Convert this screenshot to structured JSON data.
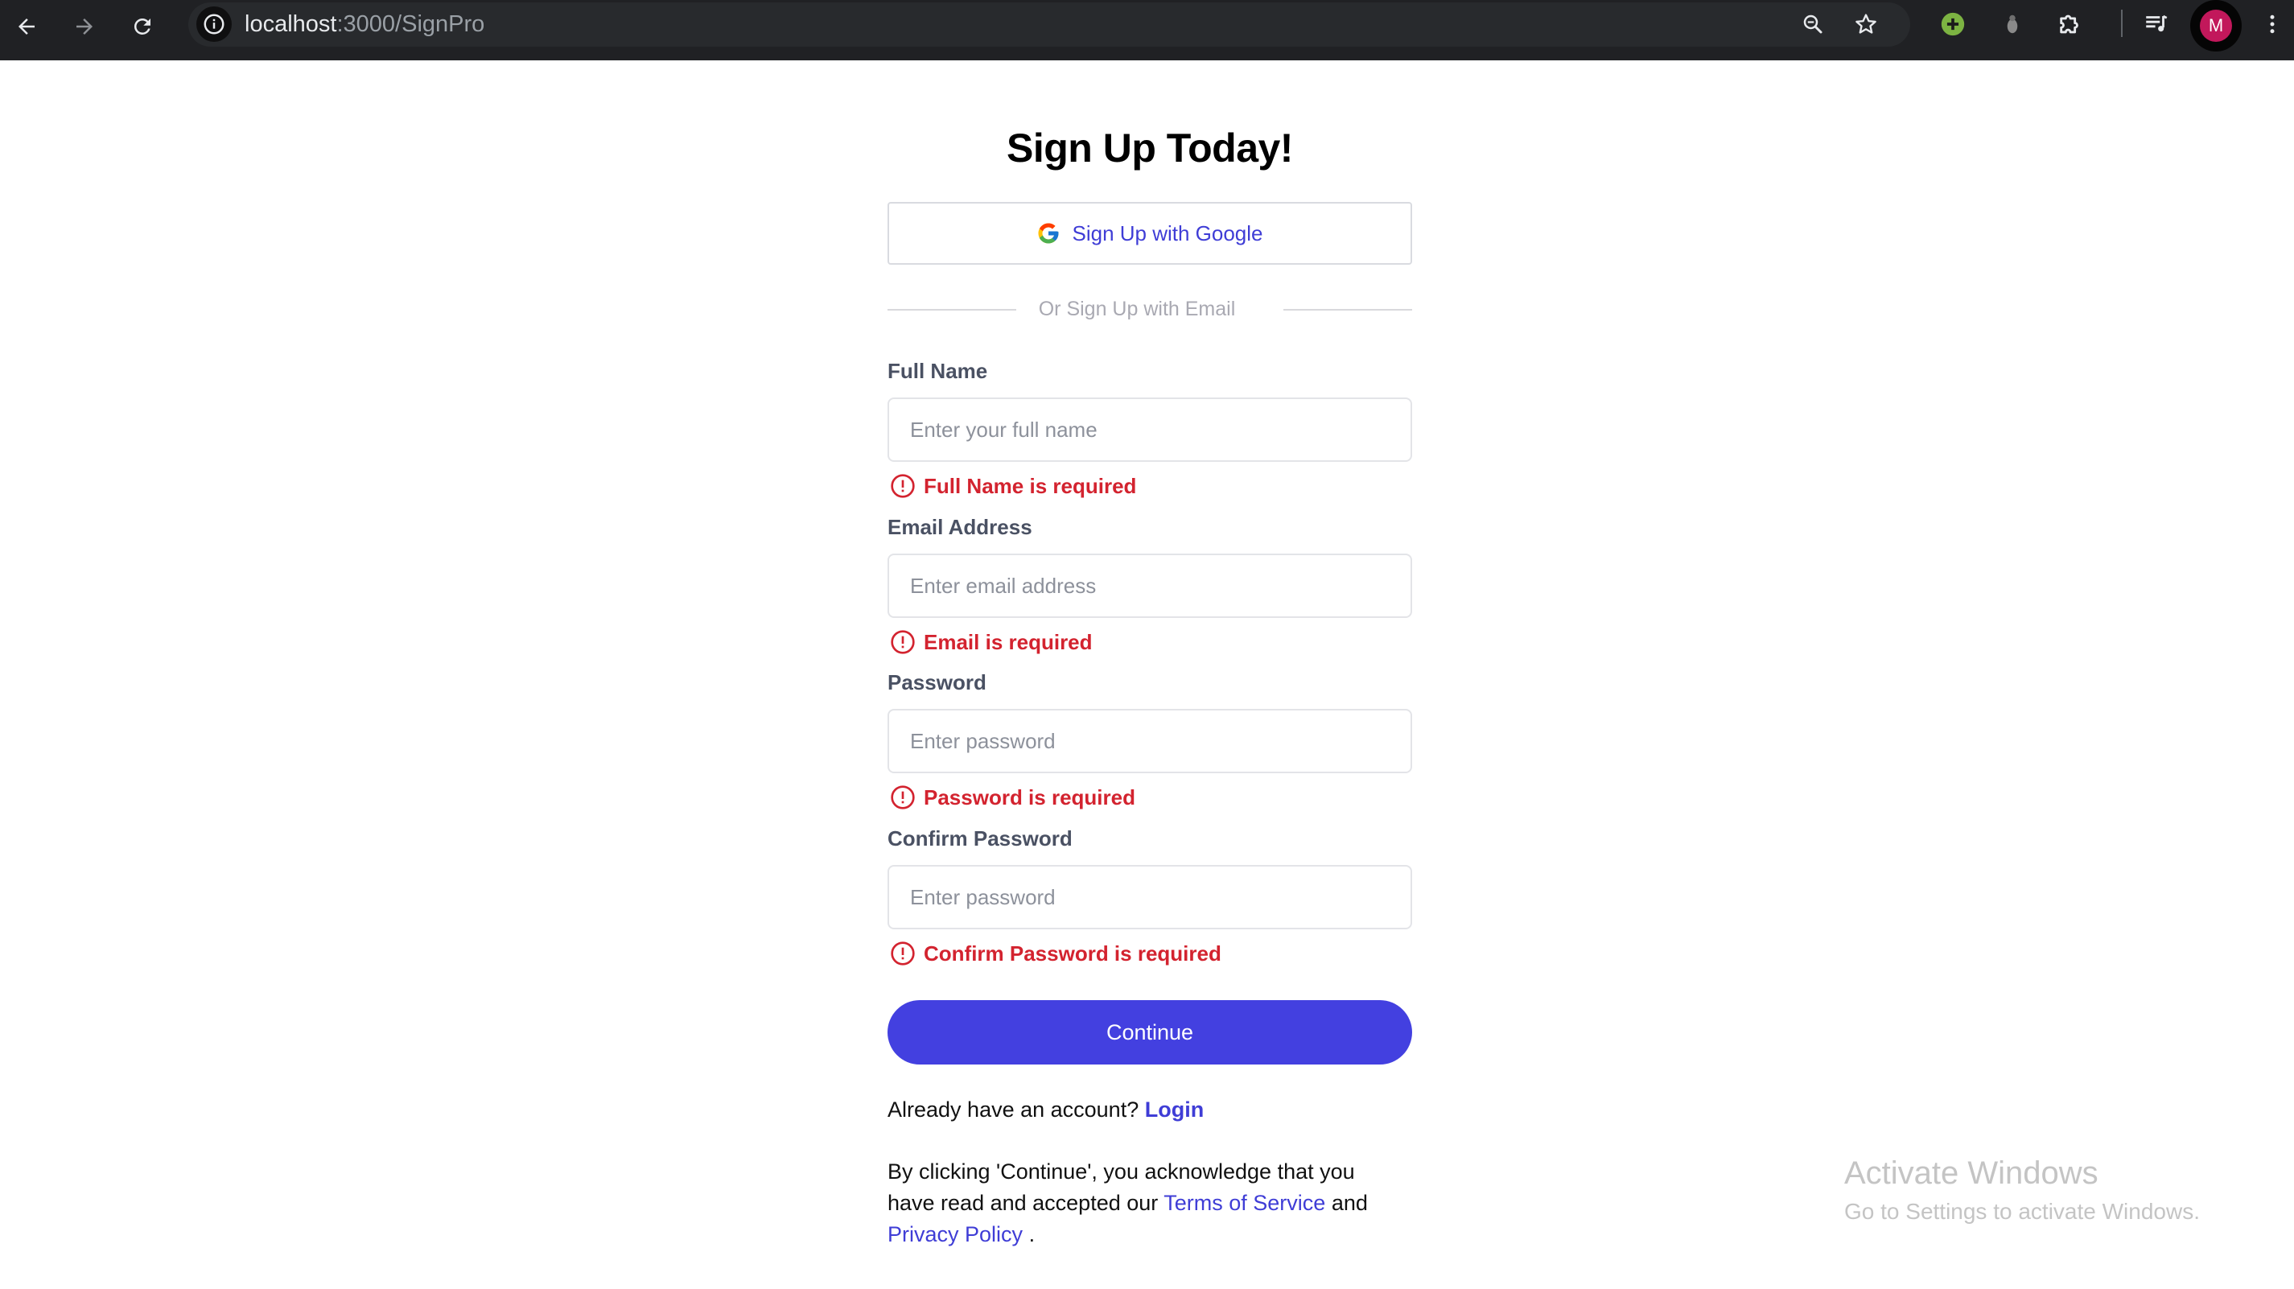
{
  "browser": {
    "url_host": "localhost",
    "url_path": ":3000/SignPro",
    "profile_initial": "M",
    "icons": {
      "back": "arrow-left",
      "forward": "arrow-right",
      "reload": "reload",
      "site_info": "info-circle",
      "zoom": "zoom-magnifier",
      "bookmark": "star",
      "extension_green": "green-plus-badge",
      "extension_grey": "grey-bug",
      "extensions": "puzzle-piece",
      "media": "music-queue",
      "menu": "three-dots-vertical"
    },
    "colors": {
      "bar": "#202124",
      "avatar": "#c2185b"
    }
  },
  "form": {
    "title": "Sign Up Today!",
    "google_button": "Sign Up with Google",
    "divider_text": "Or Sign Up with Email",
    "fields": [
      {
        "label": "Full Name",
        "placeholder": "Enter your full name",
        "error": "Full Name is required"
      },
      {
        "label": "Email Address",
        "placeholder": "Enter email address",
        "error": "Email is required"
      },
      {
        "label": "Password",
        "placeholder": "Enter password",
        "error": "Password is required"
      },
      {
        "label": "Confirm Password",
        "placeholder": "Enter password",
        "error": "Confirm Password is required"
      }
    ],
    "continue_button": "Continue",
    "login_prompt": "Already have an account?",
    "login_link": "Login",
    "terms_prefix": "By clicking 'Continue', you acknowledge that you have read and accepted our",
    "terms_link": "Terms of Service",
    "terms_and": "and",
    "privacy_link": "Privacy Policy",
    "terms_suffix": ".",
    "colors": {
      "accent": "#4340e0",
      "error": "#d3232f",
      "link": "#3f3dd6"
    }
  },
  "watermark": {
    "title": "Activate Windows",
    "subtitle": "Go to Settings to activate Windows."
  }
}
